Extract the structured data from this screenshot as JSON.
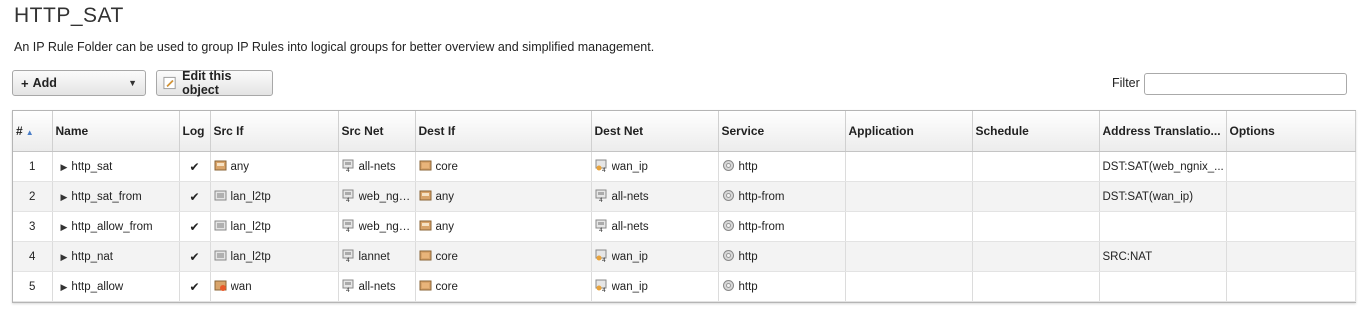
{
  "page": {
    "title": "HTTP_SAT",
    "description": "An IP Rule Folder can be used to group IP Rules into logical groups for better overview and simplified management."
  },
  "toolbar": {
    "add_label": "Add",
    "edit_label": "Edit this object",
    "filter_label": "Filter",
    "filter_value": ""
  },
  "table": {
    "columns": [
      "#",
      "Name",
      "Log",
      "Src If",
      "Src Net",
      "Dest If",
      "Dest Net",
      "Service",
      "Application",
      "Schedule",
      "Address Translatio...",
      "Options"
    ],
    "rows": [
      {
        "num": "1",
        "name": "http_sat",
        "log": "✔",
        "src_if": "any",
        "src_if_icon": "interface-icon",
        "src_net": "all-nets",
        "dest_if": "core",
        "dest_net": "wan_ip",
        "service": "http",
        "application": "",
        "schedule": "",
        "address_translation": "DST:SAT(web_ngnix_...",
        "options": ""
      },
      {
        "num": "2",
        "name": "http_sat_from",
        "log": "✔",
        "src_if": "lan_l2tp",
        "src_if_icon": "tunnel-icon",
        "src_net": "web_ngnix_",
        "dest_if": "any",
        "dest_net": "all-nets",
        "service": "http-from",
        "application": "",
        "schedule": "",
        "address_translation": "DST:SAT(wan_ip)",
        "options": ""
      },
      {
        "num": "3",
        "name": "http_allow_from",
        "log": "✔",
        "src_if": "lan_l2tp",
        "src_if_icon": "tunnel-icon",
        "src_net": "web_ngnix_",
        "dest_if": "any",
        "dest_net": "all-nets",
        "service": "http-from",
        "application": "",
        "schedule": "",
        "address_translation": "",
        "options": ""
      },
      {
        "num": "4",
        "name": "http_nat",
        "log": "✔",
        "src_if": "lan_l2tp",
        "src_if_icon": "tunnel-icon",
        "src_net": "lannet",
        "dest_if": "core",
        "dest_net": "wan_ip",
        "service": "http",
        "application": "",
        "schedule": "",
        "address_translation": "SRC:NAT",
        "options": ""
      },
      {
        "num": "5",
        "name": "http_allow",
        "log": "✔",
        "src_if": "wan",
        "src_if_icon": "ethernet-icon",
        "src_net": "all-nets",
        "dest_if": "core",
        "dest_net": "wan_ip",
        "service": "http",
        "application": "",
        "schedule": "",
        "address_translation": "",
        "options": ""
      }
    ]
  }
}
